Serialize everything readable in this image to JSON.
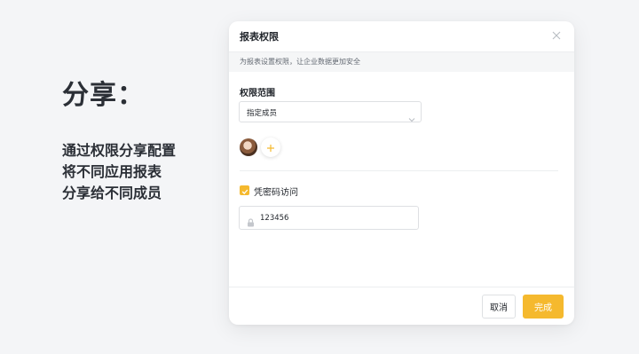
{
  "intro": {
    "title": "分享：",
    "lines": [
      "通过权限分享配置",
      "将不同应用报表",
      "分享给不同成员"
    ]
  },
  "dialog": {
    "title": "报表权限",
    "close_icon": "close-icon",
    "tip": "为报表设置权限，让企业数据更加安全",
    "scope_label": "权限范围",
    "scope_select": {
      "value": "指定成员",
      "icon": "chevron-down-icon"
    },
    "members": {
      "add_icon": "plus-icon"
    },
    "password_access": {
      "checked": true,
      "label": "凭密码访问"
    },
    "password_field": {
      "value": "123456",
      "icon": "lock-icon"
    },
    "footer": {
      "cancel_label": "取消",
      "confirm_label": "完成"
    }
  },
  "colors": {
    "accent": "#f5b92e",
    "page_bg": "#f4f5f7",
    "text": "#1f2329"
  }
}
